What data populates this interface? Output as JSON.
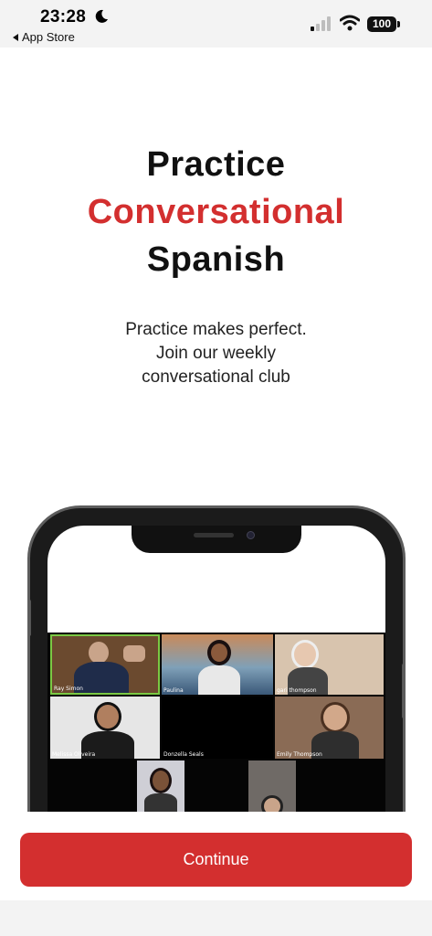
{
  "status_bar": {
    "time": "23:28",
    "back_app_label": "App Store",
    "battery": "100",
    "icons": [
      "moon-icon",
      "signal-icon",
      "wifi-icon",
      "battery-icon"
    ]
  },
  "hero": {
    "title_line1": "Practice",
    "title_line2": "Conversational",
    "title_line3": "Spanish",
    "subtitle_line1": "Practice makes perfect.",
    "subtitle_line2": "Join our weekly",
    "subtitle_line3": "conversational club"
  },
  "mockup": {
    "participants": [
      "Ray Simon",
      "Paulina",
      "gari thompson",
      "Melissa Oliveira",
      "Donzella Seals",
      "Emily Thompson"
    ],
    "app_logo": "zoom"
  },
  "actions": {
    "continue_label": "Continue"
  },
  "colors": {
    "accent": "#d32f2f",
    "title_text": "#111111",
    "background": "#ffffff"
  }
}
